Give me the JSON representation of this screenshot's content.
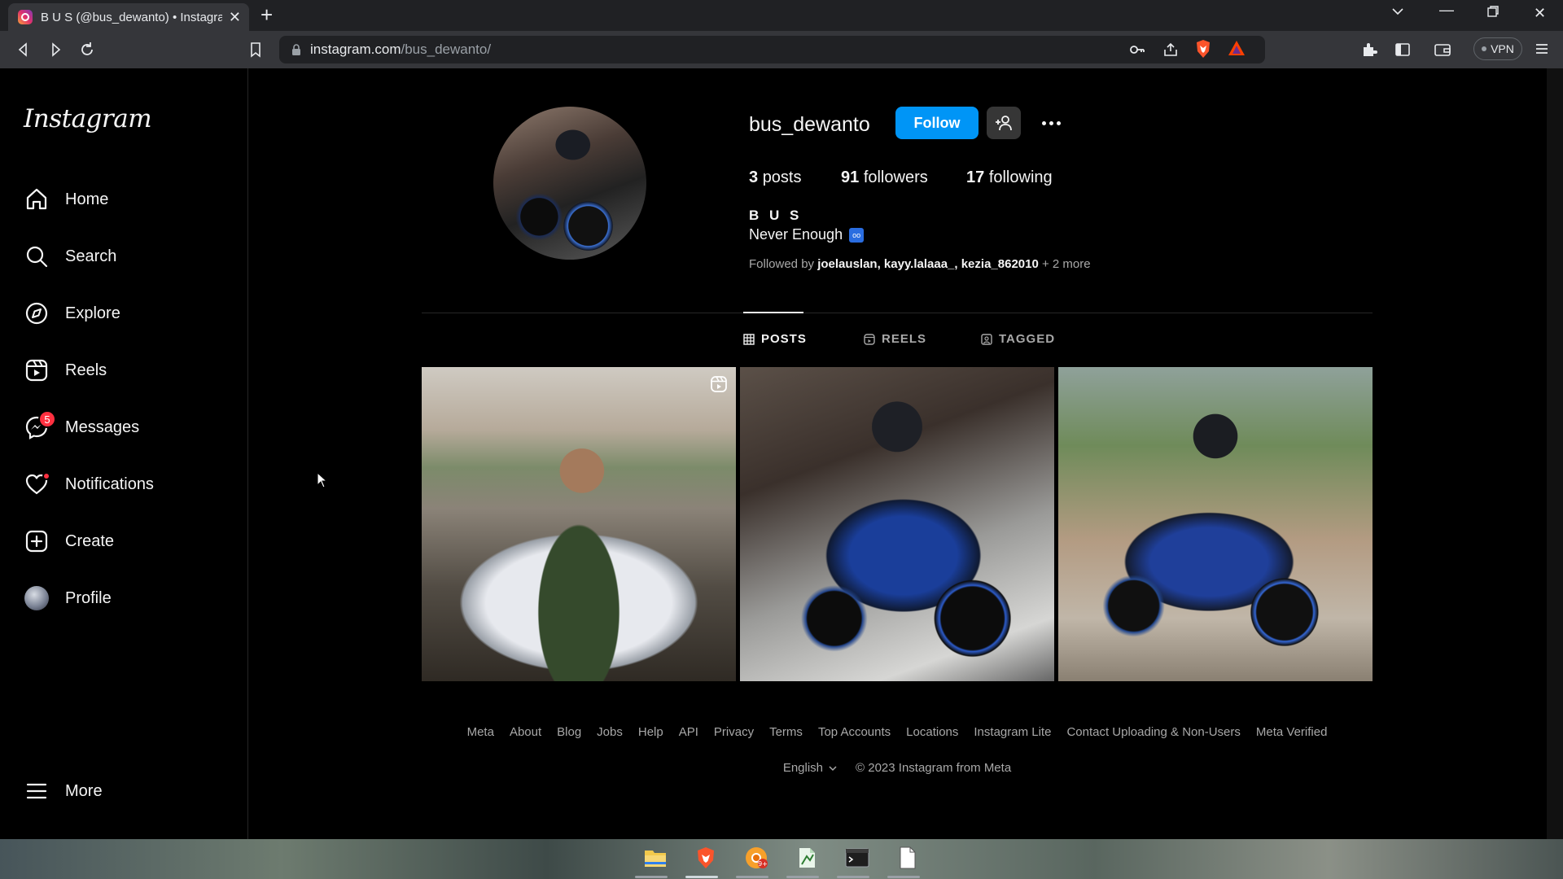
{
  "browser": {
    "tab_title": "B U S (@bus_dewanto) • Instagram",
    "url_domain": "instagram.com",
    "url_path": "/bus_dewanto/",
    "vpn_label": "VPN"
  },
  "sidebar": {
    "logo": "Instagram",
    "items": [
      {
        "label": "Home",
        "icon": "home-icon"
      },
      {
        "label": "Search",
        "icon": "search-icon"
      },
      {
        "label": "Explore",
        "icon": "compass-icon"
      },
      {
        "label": "Reels",
        "icon": "reels-icon"
      },
      {
        "label": "Messages",
        "icon": "messenger-icon",
        "badge": "5"
      },
      {
        "label": "Notifications",
        "icon": "heart-icon"
      },
      {
        "label": "Create",
        "icon": "plus-square-icon"
      },
      {
        "label": "Profile",
        "icon": "avatar"
      }
    ],
    "more_label": "More"
  },
  "profile": {
    "username": "bus_dewanto",
    "follow_label": "Follow",
    "posts_count": "3",
    "posts_label": "posts",
    "followers_count": "91",
    "followers_label": "followers",
    "following_count": "17",
    "following_label": "following",
    "full_name": "B U S",
    "bio": "Never Enough",
    "bio_emoji": "oo",
    "followed_by_prefix": "Followed by",
    "followed_by_names": "joelauslan, kayy.lalaaa_, kezia_862010",
    "followed_by_more": "+ 2 more"
  },
  "tabs": [
    {
      "label": "POSTS",
      "active": true
    },
    {
      "label": "REELS",
      "active": false
    },
    {
      "label": "TAGGED",
      "active": false
    }
  ],
  "footer": {
    "links": [
      "Meta",
      "About",
      "Blog",
      "Jobs",
      "Help",
      "API",
      "Privacy",
      "Terms",
      "Top Accounts",
      "Locations",
      "Instagram Lite",
      "Contact Uploading & Non-Users",
      "Meta Verified"
    ],
    "language": "English",
    "copyright": "© 2023 Instagram from Meta"
  },
  "colors": {
    "accent": "#0095f6",
    "badge": "#ff3040",
    "background": "#000000"
  }
}
